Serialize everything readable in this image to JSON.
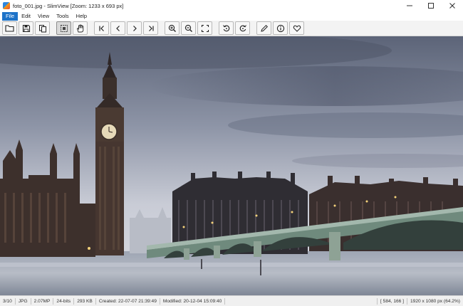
{
  "window": {
    "title": "foto_001.jpg - SlimView [Zoom: 1233 x 693 px]",
    "controls": [
      "minimize",
      "maximize",
      "close"
    ]
  },
  "menu": {
    "items": [
      {
        "label": "File",
        "active": true
      },
      {
        "label": "Edit",
        "active": false
      },
      {
        "label": "View",
        "active": false
      },
      {
        "label": "Tools",
        "active": false
      },
      {
        "label": "Help",
        "active": false
      }
    ]
  },
  "toolbar": {
    "buttons": [
      {
        "icon": "open-folder-icon"
      },
      {
        "icon": "save-icon"
      },
      {
        "icon": "copy-icon"
      },
      {
        "icon": "select-icon",
        "pressed": true
      },
      {
        "icon": "hand-pan-icon"
      },
      {
        "icon": "first-image-icon"
      },
      {
        "icon": "previous-image-icon"
      },
      {
        "icon": "next-image-icon"
      },
      {
        "icon": "last-image-icon"
      },
      {
        "icon": "zoom-in-icon"
      },
      {
        "icon": "zoom-out-icon"
      },
      {
        "icon": "fit-to-window-icon"
      },
      {
        "icon": "rotate-left-icon"
      },
      {
        "icon": "rotate-right-icon"
      },
      {
        "icon": "edit-pencil-icon"
      },
      {
        "icon": "info-icon"
      },
      {
        "icon": "favorite-heart-icon"
      }
    ]
  },
  "image": {
    "subject": "Big Ben and Westminster Bridge, London, long exposure"
  },
  "status": {
    "position": "3/10",
    "format": "JPG",
    "megapixels": "2.07MP",
    "bit_depth": "24-bits",
    "file_size": "293 KB",
    "created": "Created: 22-07-07 21:39:49",
    "modified": "Modified: 20-12-04 15:09:40",
    "cursor": "[ 584, 166 ]",
    "dimensions": "1920 x 1080 px (64.2%)"
  },
  "colors": {
    "menu_active": "#1e73c8",
    "toolbar_bg": "#f3f3f3",
    "statusbar_bg": "#f0f0f0"
  }
}
